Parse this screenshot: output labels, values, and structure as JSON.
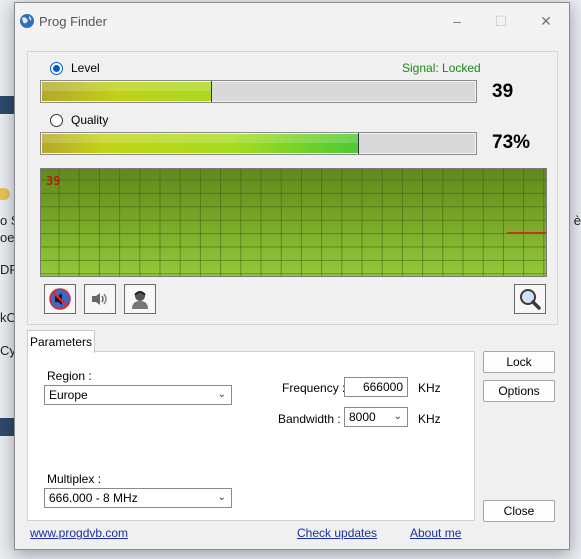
{
  "window": {
    "title": "Prog Finder"
  },
  "signal_status": "Signal: Locked",
  "level": {
    "label": "Level",
    "value_text": "39",
    "fill_fraction": 0.39,
    "selected": true
  },
  "quality": {
    "label": "Quality",
    "value_text": "73%",
    "fill_fraction": 0.73,
    "selected": false
  },
  "scope": {
    "value_label": "39"
  },
  "parameters": {
    "tab_label": "Parameters",
    "region_label": "Region :",
    "region_value": "Europe",
    "frequency_label": "Frequency :",
    "frequency_value": "666000",
    "frequency_unit": "KHz",
    "bandwidth_label": "Bandwidth :",
    "bandwidth_value": "8000",
    "bandwidth_unit": "KHz",
    "multiplex_label": "Multiplex :",
    "multiplex_value": "666.000 - 8 MHz"
  },
  "buttons": {
    "lock": "Lock",
    "options": "Options",
    "close": "Close"
  },
  "links": {
    "website": "www.progdvb.com",
    "check_updates": "Check updates",
    "about": "About me"
  },
  "background": {
    "fragments_left": [
      "o S",
      "oe",
      "DF",
      "kC",
      "Cy"
    ],
    "fragment_right": "è"
  },
  "colors": {
    "signal_green": "#1a8a1a",
    "scope_label_red": "#b51e12",
    "link_blue": "#1a2ea8"
  }
}
